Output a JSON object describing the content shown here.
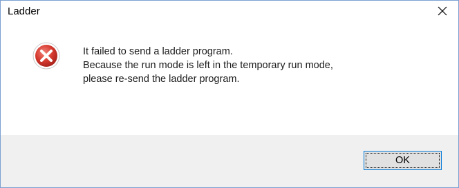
{
  "window": {
    "title": "Ladder"
  },
  "dialog": {
    "icon": "error-icon",
    "message_lines": [
      "It failed to send a ladder program.",
      "Because the run mode is left in the temporary run mode,",
      "please re-send the ladder program."
    ],
    "ok_label": "OK"
  },
  "colors": {
    "icon_red": "#d63a2f",
    "button_focus_border": "#0078d7",
    "footer_bg": "#f0f0f0"
  }
}
